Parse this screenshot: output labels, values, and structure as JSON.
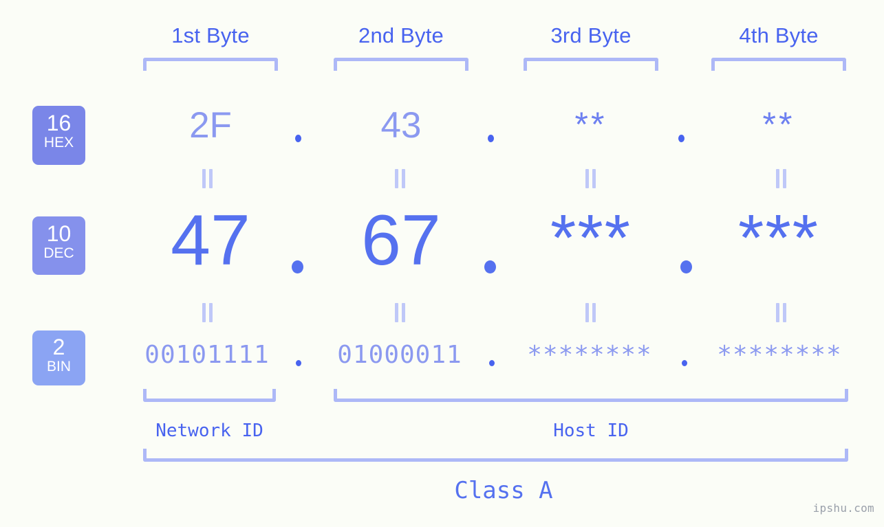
{
  "background_color": "#fbfdf7",
  "accent_colors": {
    "strong_blue": "#4863ef",
    "medium_blue": "#5571ef",
    "light_blue": "#8b99f0",
    "bracket_blue": "#adb8f7",
    "separator_blue": "#bfc8f8",
    "badge_hex": "#7a86e8",
    "badge_dec": "#8591ec",
    "badge_bin": "#8ba4f3"
  },
  "byte_headers": [
    {
      "label": "1st Byte"
    },
    {
      "label": "2nd Byte"
    },
    {
      "label": "3rd Byte"
    },
    {
      "label": "4th Byte"
    }
  ],
  "rows": {
    "hex": {
      "badge_number": "16",
      "badge_label": "HEX",
      "values": [
        "2F",
        "43",
        "**",
        "**"
      ],
      "separator": "."
    },
    "dec": {
      "badge_number": "10",
      "badge_label": "DEC",
      "values": [
        "47",
        "67",
        "***",
        "***"
      ],
      "separator": "."
    },
    "bin": {
      "badge_number": "2",
      "badge_label": "BIN",
      "values": [
        "00101111",
        "01000011",
        "********",
        "********"
      ],
      "separator": "."
    }
  },
  "equality_symbol": "=",
  "id_sections": [
    {
      "label": "Network ID"
    },
    {
      "label": "Host ID"
    }
  ],
  "class_label": "Class A",
  "watermark": "ipshu.com"
}
